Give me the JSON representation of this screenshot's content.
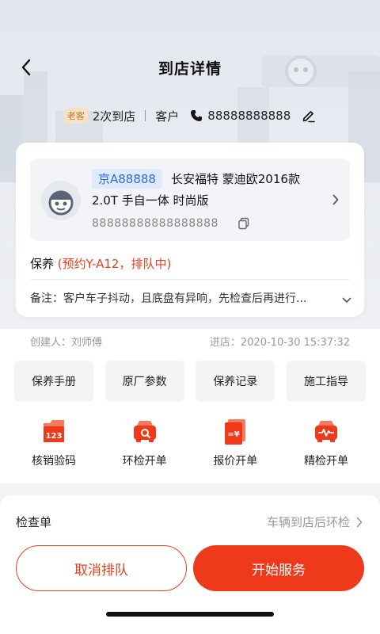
{
  "header": {
    "title": "到店详情"
  },
  "customer": {
    "badge": "老客",
    "visits": "2次到店",
    "role": "客户",
    "phone": "88888888888"
  },
  "vehicle": {
    "plate": "京A88888",
    "model_line1": "长安福特 蒙迪欧2016款",
    "model_line2": "2.0T 手自一体 时尚版",
    "vin": "88888888888888888"
  },
  "service": {
    "label": "保养",
    "status": "(预约Y-A12，排队中)",
    "remark": "备注：客户车子抖动，且底盘有异响，先检查后再进行..."
  },
  "meta": {
    "creator": "创建人：刘师傅",
    "arrival": "进店：2020-10-30 15:37:32"
  },
  "tools": [
    {
      "label": "保养手册"
    },
    {
      "label": "原厂参数"
    },
    {
      "label": "保养记录"
    },
    {
      "label": "施工指导"
    }
  ],
  "quick_actions": [
    {
      "label": "核销验码",
      "icon": "verify-code-icon"
    },
    {
      "label": "环检开单",
      "icon": "car-inspection-icon"
    },
    {
      "label": "报价开单",
      "icon": "quote-icon"
    },
    {
      "label": "精检开单",
      "icon": "detail-inspection-icon"
    }
  ],
  "checklist": {
    "title": "检查单",
    "action": "车辆到店后环检"
  },
  "buttons": {
    "cancel": "取消排队",
    "start": "开始服务"
  },
  "colors": {
    "accent": "#ee3a1b",
    "plate_bg": "#dfeaff",
    "plate_text": "#2b6fd6"
  }
}
